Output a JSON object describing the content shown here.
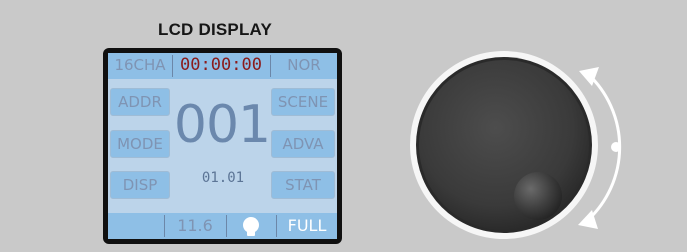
{
  "panel": {
    "title": "LCD DISPLAY"
  },
  "status_bar": {
    "channels": "16CHA",
    "timer": "00:00:00",
    "mode": "NOR"
  },
  "left_buttons": [
    {
      "label": "ADDR"
    },
    {
      "label": "MODE"
    },
    {
      "label": "DISP"
    }
  ],
  "right_buttons": [
    {
      "label": "SCENE"
    },
    {
      "label": "ADVA"
    },
    {
      "label": "STAT"
    }
  ],
  "display": {
    "address": "001",
    "version": "01.01"
  },
  "bottom_bar": {
    "value": "11.6",
    "level": "FULL",
    "icon": "bulb-icon"
  },
  "colors": {
    "background": "#c9c9c9",
    "screen": "#bcd4ea",
    "button": "#8ebfe6",
    "text": "#7f94b3",
    "timer": "#8b1a1a",
    "knob": "#3c3c3c"
  }
}
